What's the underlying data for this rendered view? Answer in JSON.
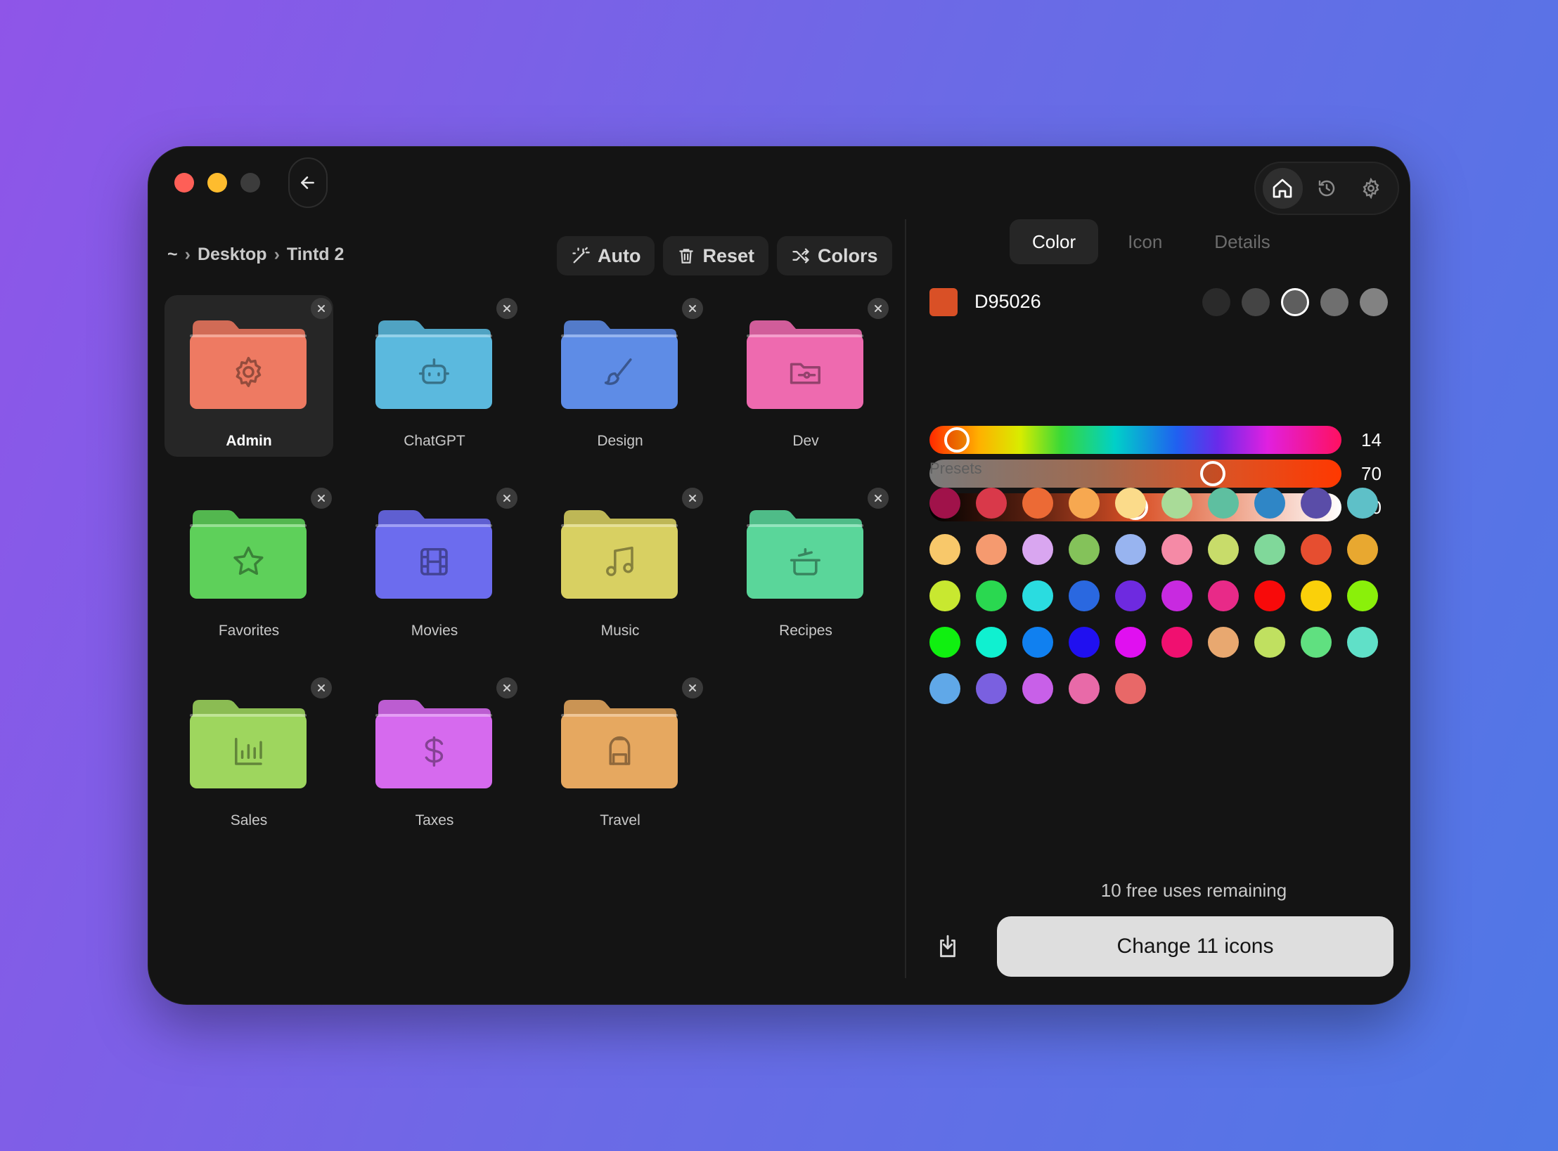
{
  "window": {
    "breadcrumb": {
      "home": "~",
      "sep1": "›",
      "folder1": "Desktop",
      "sep2": "›",
      "folder2": "Tintd 2"
    },
    "top_icons": [
      "home-icon",
      "history-icon",
      "gear-icon"
    ]
  },
  "toolbar": {
    "auto_label": "Auto",
    "reset_label": "Reset",
    "colors_label": "Colors"
  },
  "folders": [
    {
      "name": "Admin",
      "color": "#EE7A62",
      "icon": "gear-icon",
      "selected": true
    },
    {
      "name": "ChatGPT",
      "color": "#5BB9DE",
      "icon": "robot-icon"
    },
    {
      "name": "Design",
      "color": "#5E8CE6",
      "icon": "brush-icon"
    },
    {
      "name": "Dev",
      "color": "#EE6AAF",
      "icon": "folder-code-icon"
    },
    {
      "name": "Favorites",
      "color": "#5ED05A",
      "icon": "star-icon"
    },
    {
      "name": "Movies",
      "color": "#6C6CEE",
      "icon": "film-icon"
    },
    {
      "name": "Music",
      "color": "#D8D062",
      "icon": "music-icon"
    },
    {
      "name": "Recipes",
      "color": "#5AD69A",
      "icon": "cooking-pot-icon"
    },
    {
      "name": "Sales",
      "color": "#9ED65E",
      "icon": "bar-chart-icon"
    },
    {
      "name": "Taxes",
      "color": "#D66AEE",
      "icon": "dollar-icon"
    },
    {
      "name": "Travel",
      "color": "#E6A860",
      "icon": "backpack-icon"
    }
  ],
  "panel": {
    "tabs": {
      "color": "Color",
      "icon": "Icon",
      "details": "Details"
    },
    "active_tab": "Color",
    "hex": "D95026",
    "swatch_color": "#D95026",
    "tones": [
      "#2a2a2a",
      "#444444",
      "#5e5e5e",
      "#6f6f6f",
      "#828282"
    ],
    "selected_tone": 2,
    "sliders": {
      "hue": 14,
      "saturation": 70,
      "lightness": 50
    },
    "presets_label": "Presets",
    "presets": [
      "#A0124A",
      "#D9394A",
      "#EC6A35",
      "#F7A850",
      "#FBDB8A",
      "#A9DB98",
      "#5EBFA0",
      "#2F86C6",
      "#5A4DA8",
      "#5EC0C8",
      "#F8C86A",
      "#F59A6F",
      "#D9A6F0",
      "#84C25A",
      "#98B4F0",
      "#F58AA6",
      "#C8DC6A",
      "#80D89A",
      "#E64E30",
      "#E8A830",
      "#C8E830",
      "#2AD850",
      "#2ADCE0",
      "#2A68E0",
      "#6E2AE0",
      "#C82AE0",
      "#E82A88",
      "#F80A0A",
      "#FAD00A",
      "#8AF00A",
      "#10F010",
      "#10F0D0",
      "#1080F0",
      "#2010F0",
      "#E010F0",
      "#F01070",
      "#E8A870",
      "#C0E060",
      "#60E080",
      "#60E0C8",
      "#60A8E8",
      "#7A60E0",
      "#C860E8",
      "#E86AA8",
      "#E86868"
    ],
    "uses_text": "10 free uses remaining",
    "primary_label": "Change 11 icons"
  }
}
